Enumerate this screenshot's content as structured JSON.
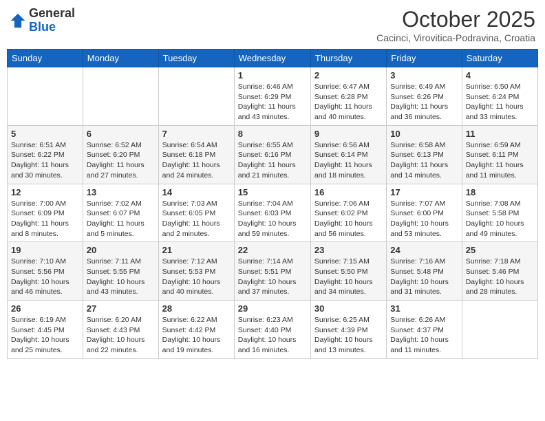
{
  "header": {
    "logo_general": "General",
    "logo_blue": "Blue",
    "month_title": "October 2025",
    "location": "Cacinci, Virovitica-Podravina, Croatia"
  },
  "weekdays": [
    "Sunday",
    "Monday",
    "Tuesday",
    "Wednesday",
    "Thursday",
    "Friday",
    "Saturday"
  ],
  "weeks": [
    [
      {
        "day": "",
        "info": ""
      },
      {
        "day": "",
        "info": ""
      },
      {
        "day": "",
        "info": ""
      },
      {
        "day": "1",
        "info": "Sunrise: 6:46 AM\nSunset: 6:29 PM\nDaylight: 11 hours\nand 43 minutes."
      },
      {
        "day": "2",
        "info": "Sunrise: 6:47 AM\nSunset: 6:28 PM\nDaylight: 11 hours\nand 40 minutes."
      },
      {
        "day": "3",
        "info": "Sunrise: 6:49 AM\nSunset: 6:26 PM\nDaylight: 11 hours\nand 36 minutes."
      },
      {
        "day": "4",
        "info": "Sunrise: 6:50 AM\nSunset: 6:24 PM\nDaylight: 11 hours\nand 33 minutes."
      }
    ],
    [
      {
        "day": "5",
        "info": "Sunrise: 6:51 AM\nSunset: 6:22 PM\nDaylight: 11 hours\nand 30 minutes."
      },
      {
        "day": "6",
        "info": "Sunrise: 6:52 AM\nSunset: 6:20 PM\nDaylight: 11 hours\nand 27 minutes."
      },
      {
        "day": "7",
        "info": "Sunrise: 6:54 AM\nSunset: 6:18 PM\nDaylight: 11 hours\nand 24 minutes."
      },
      {
        "day": "8",
        "info": "Sunrise: 6:55 AM\nSunset: 6:16 PM\nDaylight: 11 hours\nand 21 minutes."
      },
      {
        "day": "9",
        "info": "Sunrise: 6:56 AM\nSunset: 6:14 PM\nDaylight: 11 hours\nand 18 minutes."
      },
      {
        "day": "10",
        "info": "Sunrise: 6:58 AM\nSunset: 6:13 PM\nDaylight: 11 hours\nand 14 minutes."
      },
      {
        "day": "11",
        "info": "Sunrise: 6:59 AM\nSunset: 6:11 PM\nDaylight: 11 hours\nand 11 minutes."
      }
    ],
    [
      {
        "day": "12",
        "info": "Sunrise: 7:00 AM\nSunset: 6:09 PM\nDaylight: 11 hours\nand 8 minutes."
      },
      {
        "day": "13",
        "info": "Sunrise: 7:02 AM\nSunset: 6:07 PM\nDaylight: 11 hours\nand 5 minutes."
      },
      {
        "day": "14",
        "info": "Sunrise: 7:03 AM\nSunset: 6:05 PM\nDaylight: 11 hours\nand 2 minutes."
      },
      {
        "day": "15",
        "info": "Sunrise: 7:04 AM\nSunset: 6:03 PM\nDaylight: 10 hours\nand 59 minutes."
      },
      {
        "day": "16",
        "info": "Sunrise: 7:06 AM\nSunset: 6:02 PM\nDaylight: 10 hours\nand 56 minutes."
      },
      {
        "day": "17",
        "info": "Sunrise: 7:07 AM\nSunset: 6:00 PM\nDaylight: 10 hours\nand 53 minutes."
      },
      {
        "day": "18",
        "info": "Sunrise: 7:08 AM\nSunset: 5:58 PM\nDaylight: 10 hours\nand 49 minutes."
      }
    ],
    [
      {
        "day": "19",
        "info": "Sunrise: 7:10 AM\nSunset: 5:56 PM\nDaylight: 10 hours\nand 46 minutes."
      },
      {
        "day": "20",
        "info": "Sunrise: 7:11 AM\nSunset: 5:55 PM\nDaylight: 10 hours\nand 43 minutes."
      },
      {
        "day": "21",
        "info": "Sunrise: 7:12 AM\nSunset: 5:53 PM\nDaylight: 10 hours\nand 40 minutes."
      },
      {
        "day": "22",
        "info": "Sunrise: 7:14 AM\nSunset: 5:51 PM\nDaylight: 10 hours\nand 37 minutes."
      },
      {
        "day": "23",
        "info": "Sunrise: 7:15 AM\nSunset: 5:50 PM\nDaylight: 10 hours\nand 34 minutes."
      },
      {
        "day": "24",
        "info": "Sunrise: 7:16 AM\nSunset: 5:48 PM\nDaylight: 10 hours\nand 31 minutes."
      },
      {
        "day": "25",
        "info": "Sunrise: 7:18 AM\nSunset: 5:46 PM\nDaylight: 10 hours\nand 28 minutes."
      }
    ],
    [
      {
        "day": "26",
        "info": "Sunrise: 6:19 AM\nSunset: 4:45 PM\nDaylight: 10 hours\nand 25 minutes."
      },
      {
        "day": "27",
        "info": "Sunrise: 6:20 AM\nSunset: 4:43 PM\nDaylight: 10 hours\nand 22 minutes."
      },
      {
        "day": "28",
        "info": "Sunrise: 6:22 AM\nSunset: 4:42 PM\nDaylight: 10 hours\nand 19 minutes."
      },
      {
        "day": "29",
        "info": "Sunrise: 6:23 AM\nSunset: 4:40 PM\nDaylight: 10 hours\nand 16 minutes."
      },
      {
        "day": "30",
        "info": "Sunrise: 6:25 AM\nSunset: 4:39 PM\nDaylight: 10 hours\nand 13 minutes."
      },
      {
        "day": "31",
        "info": "Sunrise: 6:26 AM\nSunset: 4:37 PM\nDaylight: 10 hours\nand 11 minutes."
      },
      {
        "day": "",
        "info": ""
      }
    ]
  ]
}
